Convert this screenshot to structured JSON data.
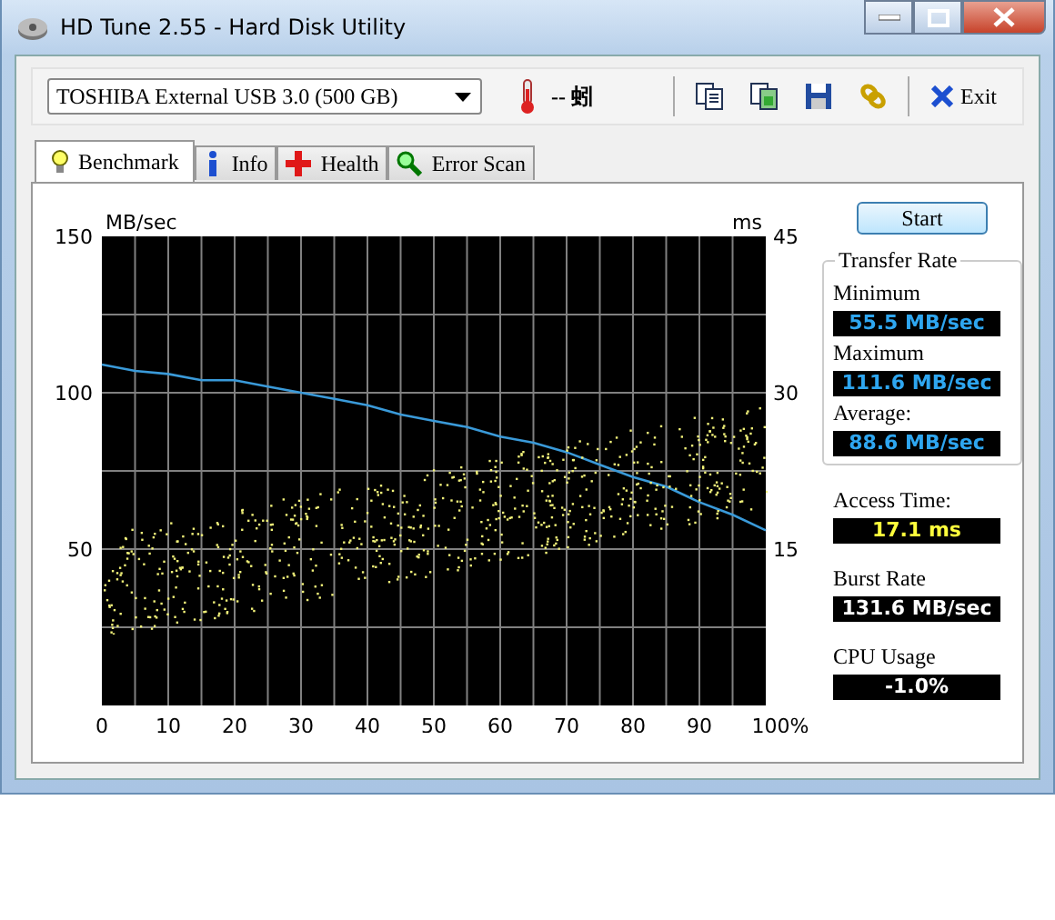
{
  "window": {
    "title": "HD Tune 2.55 - Hard Disk Utility"
  },
  "toolbar": {
    "drive": "TOSHIBA External USB 3.0 (500 GB)",
    "temperature": "-- 蚓",
    "exit": "Exit"
  },
  "tabs": [
    {
      "label": "Benchmark",
      "selected": true
    },
    {
      "label": "Info",
      "selected": false
    },
    {
      "label": "Health",
      "selected": false
    },
    {
      "label": "Error Scan",
      "selected": false
    }
  ],
  "benchmark": {
    "right_axis": {
      "label": "ms",
      "ticks": [
        "45",
        "30",
        "15"
      ]
    },
    "chart_data": {
      "type": "line",
      "grid": true,
      "ylabel": "MB/sec",
      "x": [
        0,
        5,
        10,
        15,
        20,
        25,
        30,
        35,
        40,
        45,
        50,
        55,
        60,
        65,
        70,
        75,
        80,
        85,
        90,
        95,
        100
      ],
      "series": [
        {
          "color": "#3a9ad9",
          "values": [
            109,
            107,
            106,
            104,
            104,
            102,
            100,
            98,
            96,
            93,
            91,
            89,
            86,
            84,
            81,
            77,
            73,
            70,
            65,
            61,
            56
          ]
        }
      ],
      "xlim": [
        0,
        100
      ],
      "ylim": [
        0,
        150
      ],
      "xticks": [
        0,
        10,
        20,
        30,
        40,
        50,
        60,
        70,
        80,
        90,
        {
          "value": 100,
          "label": "100%"
        }
      ],
      "yticks": [
        50,
        100,
        150
      ]
    },
    "start": "Start",
    "transfer_rate": {
      "title": "Transfer Rate",
      "readings": [
        {
          "label": "Minimum",
          "value": "55.5 MB/sec",
          "kind": "rate"
        },
        {
          "label": "Maximum",
          "value": "111.6 MB/sec",
          "kind": "rate"
        },
        {
          "label": "Average:",
          "value": "88.6 MB/sec",
          "kind": "rate"
        }
      ]
    },
    "stats": [
      {
        "label": "Access Time:",
        "value": "17.1 ms",
        "kind": "time"
      },
      {
        "label": "Burst Rate",
        "value": "131.6 MB/sec",
        "kind": "plain"
      },
      {
        "label": "CPU Usage",
        "value": "-1.0%",
        "kind": "plain"
      }
    ]
  }
}
